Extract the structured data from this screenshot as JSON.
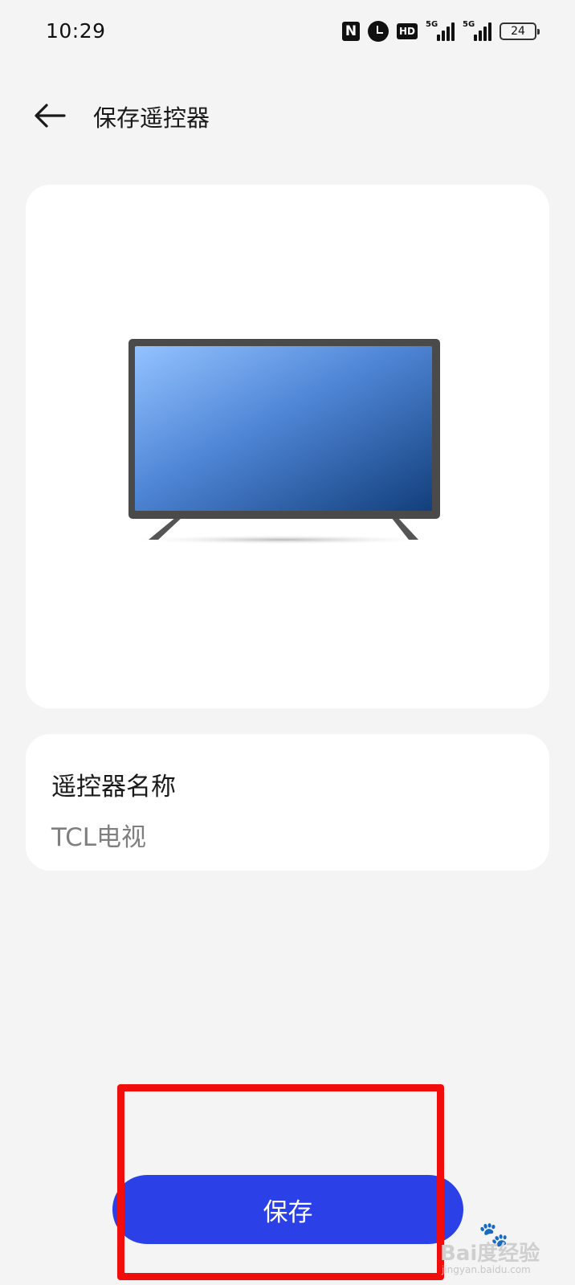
{
  "status_bar": {
    "time": "10:29",
    "battery": "24",
    "hd_label": "HD",
    "sim1_tag": "5G",
    "sim2_tag": "5G",
    "icons": [
      "nfc-icon",
      "alarm-icon",
      "hd-voice-icon",
      "signal-5g-icon",
      "signal-5g-icon",
      "battery-icon"
    ]
  },
  "header": {
    "back_icon": "arrow-left-icon",
    "title": "保存遥控器"
  },
  "device_card": {
    "image": "tv-icon"
  },
  "name_card": {
    "label": "遥控器名称",
    "value": "TCL电视"
  },
  "actions": {
    "save_label": "保存"
  },
  "colors": {
    "background": "#f4f4f4",
    "card": "#ffffff",
    "primary_button": "#2b40e6",
    "highlight": "#f20d0d",
    "secondary_text": "#7f7f7f"
  },
  "watermark": {
    "main": "Bai度经验",
    "sub": "jingyan.baidu.com"
  }
}
